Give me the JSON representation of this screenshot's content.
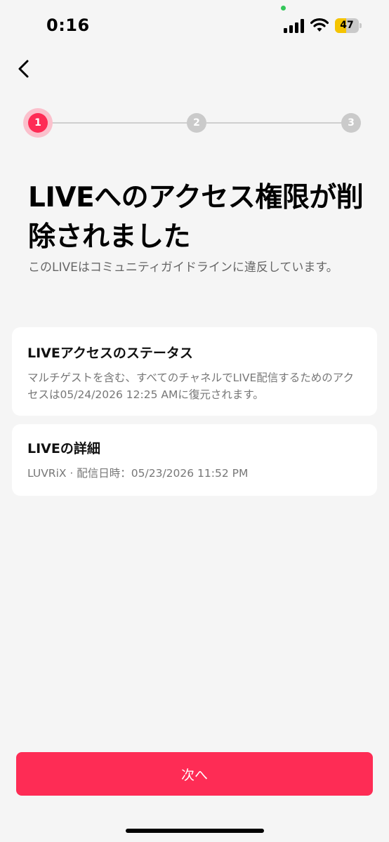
{
  "status_bar": {
    "time": "0:16",
    "battery_level": "47",
    "battery_fraction": 0.47,
    "battery_color": "#f5c400"
  },
  "icons": {
    "back": "chevron-left-icon",
    "signal": "cellular-signal-icon",
    "wifi": "wifi-icon"
  },
  "stepper": {
    "steps": [
      "1",
      "2",
      "3"
    ],
    "current": 1,
    "active_color": "#fe2c55",
    "inactive_color": "#cacaca"
  },
  "header": {
    "title": "LIVEへのアクセス権限が削除されました",
    "subtitle": "このLIVEはコミュニティガイドラインに違反しています。"
  },
  "status_card": {
    "title": "LIVEアクセスのステータス",
    "body": "マルチゲストを含む、すべてのチャネルでLIVE配信するためのアクセスは05/24/2026 12:25 AMに復元されます。"
  },
  "details_card": {
    "title": "LIVEの詳細",
    "body": "LUVRiX · 配信日時：05/23/2026 11:52 PM"
  },
  "footer": {
    "next_label": "次へ",
    "accent": "#fe2c55"
  }
}
